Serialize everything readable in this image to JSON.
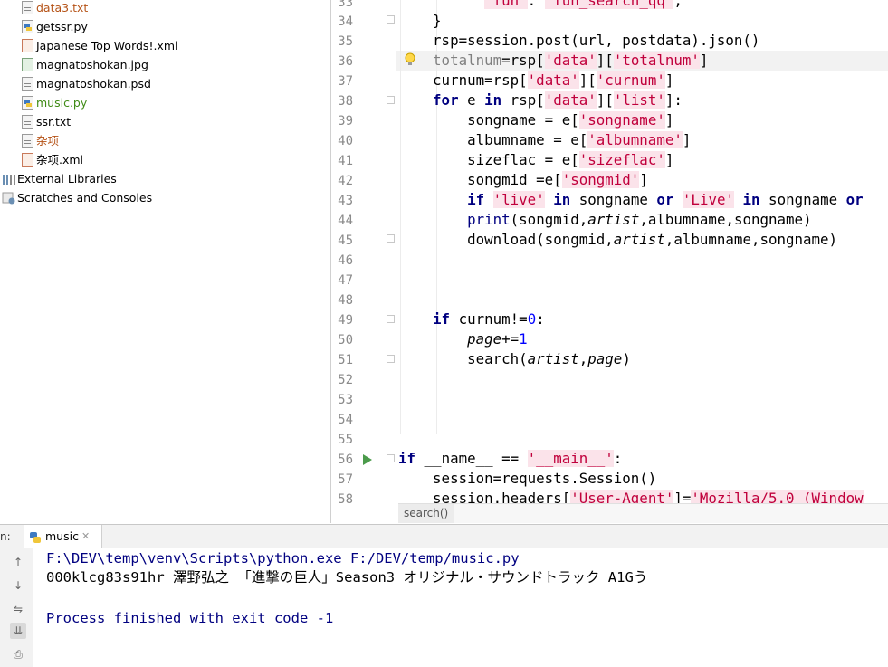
{
  "project_tree": {
    "items": [
      {
        "label": "data3.txt",
        "icon": "text-file-icon",
        "color": "#b55216"
      },
      {
        "label": "getssr.py",
        "icon": "python-file-icon",
        "color": "#000000"
      },
      {
        "label": "Japanese Top Words!.xml",
        "icon": "xml-file-icon",
        "color": "#000000"
      },
      {
        "label": "magnatoshokan.jpg",
        "icon": "image-file-icon",
        "color": "#000000"
      },
      {
        "label": "magnatoshokan.psd",
        "icon": "text-file-icon",
        "color": "#000000"
      },
      {
        "label": "music.py",
        "icon": "python-file-icon",
        "color": "#3f8b16"
      },
      {
        "label": "ssr.txt",
        "icon": "text-file-icon",
        "color": "#000000"
      },
      {
        "label": "杂项",
        "icon": "text-file-icon",
        "color": "#b55216"
      },
      {
        "label": "杂项.xml",
        "icon": "xml-file-icon",
        "color": "#000000"
      }
    ],
    "external_libraries": "External Libraries",
    "scratches": "Scratches and Consoles"
  },
  "editor": {
    "line_numbers": [
      "33",
      "34",
      "35",
      "36",
      "37",
      "38",
      "39",
      "40",
      "41",
      "42",
      "43",
      "44",
      "45",
      "46",
      "47",
      "48",
      "49",
      "50",
      "51",
      "52",
      "53",
      "54",
      "55",
      "56",
      "57",
      "58"
    ],
    "breadcrumb": "search()",
    "current_line": "36",
    "colors": {
      "keyword": "#000080",
      "string": "#008000",
      "number": "#0000ff",
      "highlight": "#f2f2f2"
    }
  },
  "run_panel": {
    "prefix": "n:",
    "tab_label": "music",
    "console": {
      "line1": "F:\\DEV\\temp\\venv\\Scripts\\python.exe F:/DEV/temp/music.py",
      "line2": "000klcg83s91hr 澤野弘之 「進撃の巨人」Season3 オリジナル・サウンドトラック A1Gう",
      "line3": "Process finished with exit code -1"
    }
  }
}
